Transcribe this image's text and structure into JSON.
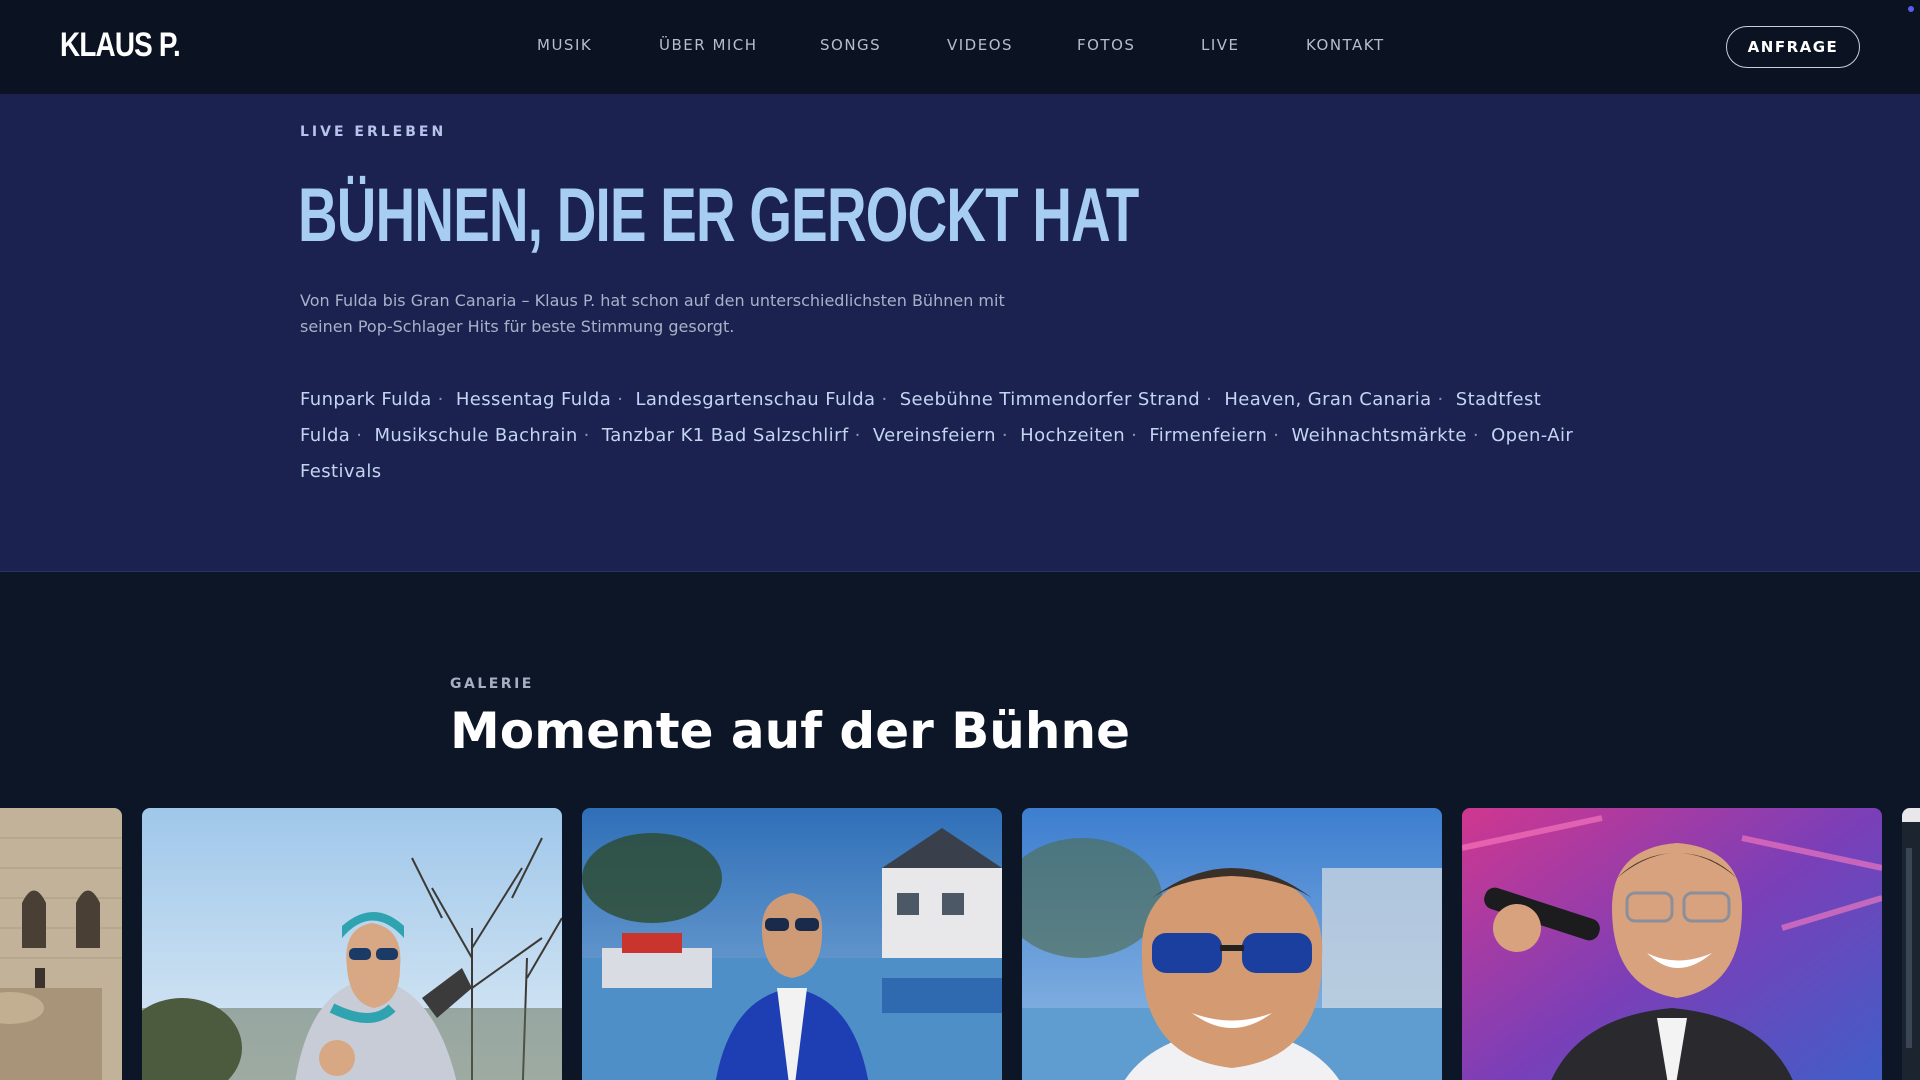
{
  "header": {
    "logo": "KLAUS P.",
    "nav": [
      "MUSIK",
      "ÜBER MICH",
      "SONGS",
      "VIDEOS",
      "FOTOS",
      "LIVE",
      "KONTAKT"
    ],
    "cta": "ANFRAGE"
  },
  "live": {
    "eyebrow": "LIVE ERLEBEN",
    "headline": "BÜHNEN, DIE ER GEROCKT HAT",
    "intro": "Von Fulda bis Gran Canaria – Klaus P. hat schon auf den unterschiedlichsten Bühnen mit seinen Pop-Schlager Hits für beste Stimmung gesorgt.",
    "venues": [
      "Funpark Fulda",
      "Hessentag Fulda",
      "Landesgartenschau Fulda",
      "Seebühne Timmendorfer Strand",
      "Heaven, Gran Canaria",
      "Stadtfest Fulda",
      "Musikschule Bachrain",
      "Tanzbar K1 Bad Salzschlirf",
      "Vereinsfeiern",
      "Hochzeiten",
      "Firmenfeiern",
      "Weihnachtsmärkte",
      "Open-Air Festivals"
    ]
  },
  "gallery": {
    "eyebrow": "GALERIE",
    "title": "Momente auf der Bühne"
  },
  "colors": {
    "header_bg": "#0b1222",
    "live_bg": "#1b2250",
    "headline": "#a7cdf2",
    "gallery_bg": "#0d1626"
  }
}
